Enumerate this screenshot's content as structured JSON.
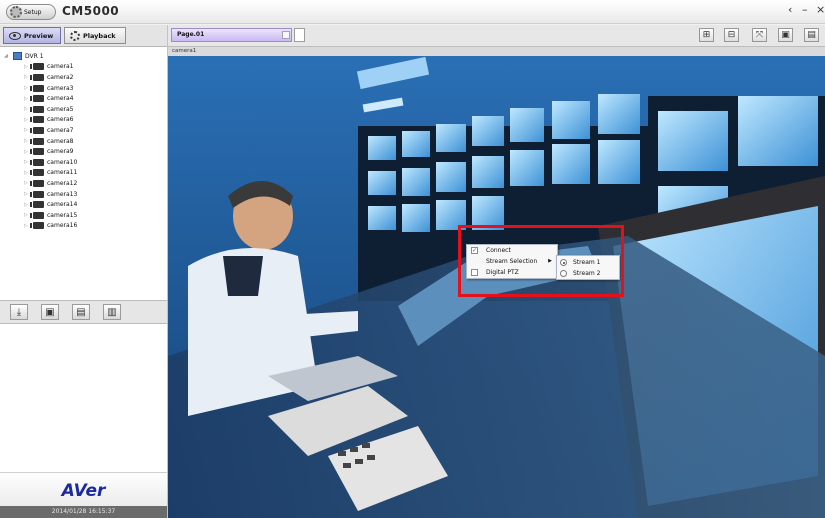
{
  "app": {
    "setup_label": "Setup",
    "title": "CM5000",
    "window_controls": [
      "‹",
      "–",
      "×"
    ]
  },
  "left": {
    "tabs": [
      {
        "label": "Preview",
        "active": true
      },
      {
        "label": "Playback",
        "active": false
      }
    ],
    "tree": {
      "dvr_label": "DVR 1",
      "cameras": [
        "camera1",
        "camera2",
        "camera3",
        "camera4",
        "camera5",
        "camera6",
        "camera7",
        "camera8",
        "camera9",
        "camera10",
        "camera11",
        "camera12",
        "camera13",
        "camera14",
        "camera15",
        "camera16"
      ]
    },
    "ptz_icons": [
      "download-icon",
      "snapshot-icon",
      "record-icon",
      "audio-icon"
    ],
    "logo": "AVer",
    "datetime": "2014/01/28 16:15:37"
  },
  "main": {
    "page_tab_label": "Page.01",
    "toolbar_icons": [
      "layout-grid-icon",
      "layout-select-icon",
      "fullscreen-icon",
      "snapshot-icon",
      "display-icon"
    ],
    "camera_label": "camera1"
  },
  "context_menu": {
    "items": [
      {
        "label": "Connect",
        "checked": true
      },
      {
        "label": "Stream Selection",
        "submenu": true
      },
      {
        "label": "Digital PTZ",
        "checked": false
      }
    ],
    "stream_submenu": [
      {
        "label": "Stream 1",
        "selected": true
      },
      {
        "label": "Stream 2",
        "selected": false
      }
    ]
  },
  "colors": {
    "highlight_box": "#e4101b",
    "preview_tab": "#b3b3e4",
    "page_tab": "#c9b9f2",
    "logo": "#1b2aa0"
  }
}
